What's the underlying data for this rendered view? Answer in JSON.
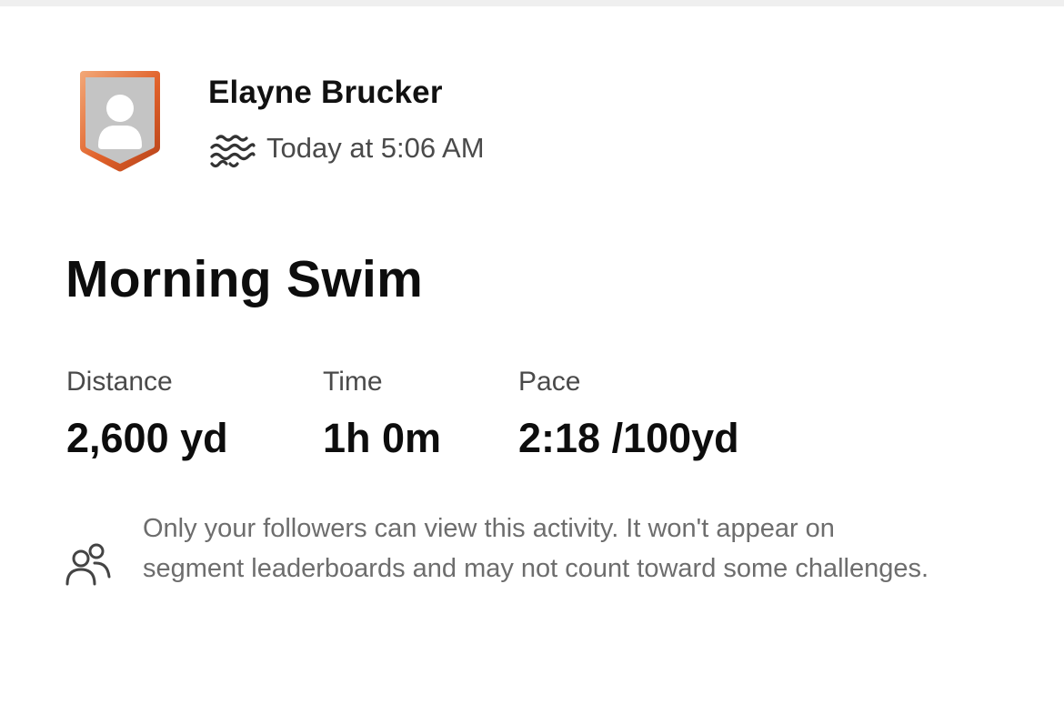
{
  "athlete": {
    "name": "Elayne Brucker",
    "avatar_icon": "person-silhouette-icon",
    "avatar_border_colors": [
      "#f0a070",
      "#e0612a",
      "#b8471b"
    ],
    "avatar_fill": "#c4c4c4"
  },
  "activity": {
    "type_icon": "swim-waves-icon",
    "timestamp": "Today at 5:06 AM",
    "title": "Morning Swim"
  },
  "stats": [
    {
      "label": "Distance",
      "value": "2,600 yd"
    },
    {
      "label": "Time",
      "value": "1h 0m"
    },
    {
      "label": "Pace",
      "value": "2:18 /100yd"
    }
  ],
  "privacy": {
    "icon": "followers-icon",
    "note": "Only your followers can view this activity. It won't appear on segment leaderboards and may not count toward some challenges."
  },
  "colors": {
    "text_primary": "#111111",
    "text_secondary": "#4a4a4a",
    "text_muted": "#6d6d6d",
    "accent": "#e0612a"
  }
}
